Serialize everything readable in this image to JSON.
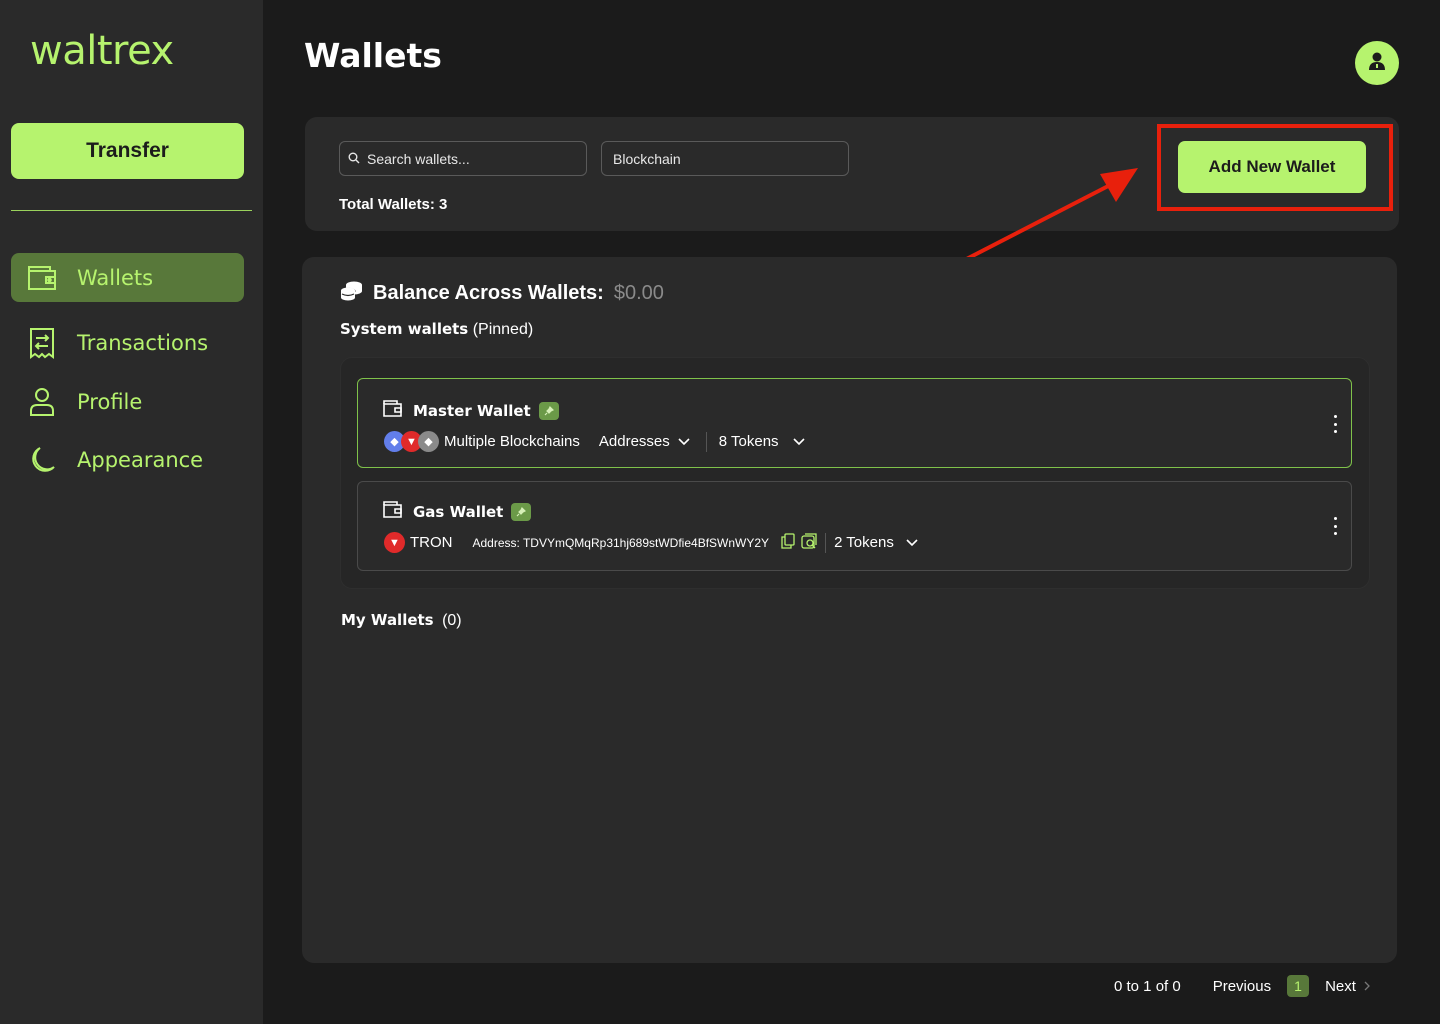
{
  "app": {
    "logo": "waltrex"
  },
  "sidebar": {
    "transfer_label": "Transfer",
    "items": [
      {
        "label": "Wallets",
        "icon": "wallet-icon",
        "active": true
      },
      {
        "label": "Transactions",
        "icon": "receipt-icon",
        "active": false
      },
      {
        "label": "Profile",
        "icon": "user-icon",
        "active": false
      },
      {
        "label": "Appearance",
        "icon": "moon-icon",
        "active": false
      }
    ]
  },
  "header": {
    "title": "Wallets",
    "avatar_icon": "user-icon"
  },
  "filters": {
    "search_placeholder": "Search wallets...",
    "blockchain_label": "Blockchain",
    "total_wallets": "Total Wallets: 3",
    "add_wallet_label": "Add New Wallet"
  },
  "balance": {
    "label": "Balance Across Wallets:",
    "value": "$0.00"
  },
  "system_wallets": {
    "title": "System wallets",
    "suffix": "(Pinned)",
    "wallets": [
      {
        "name": "Master Wallet",
        "chains_label": "Multiple Blockchains",
        "addresses_label": "Addresses",
        "tokens_label": "8 Tokens"
      },
      {
        "name": "Gas Wallet",
        "chain": "TRON",
        "address": "Address: TDVYmQMqRp31hj689stWDfie4BfSWnWY2Y",
        "tokens_label": "2 Tokens"
      }
    ]
  },
  "my_wallets": {
    "title": "My Wallets",
    "count": "(0)"
  },
  "pagination": {
    "range": "0 to 1 of 0",
    "previous": "Previous",
    "page": "1",
    "next": "Next"
  },
  "colors": {
    "accent": "#b6f36e",
    "active_nav": "#58783a",
    "annotation": "#e8200c",
    "background": "#1b1b1b",
    "panel": "#2a2a2a"
  }
}
